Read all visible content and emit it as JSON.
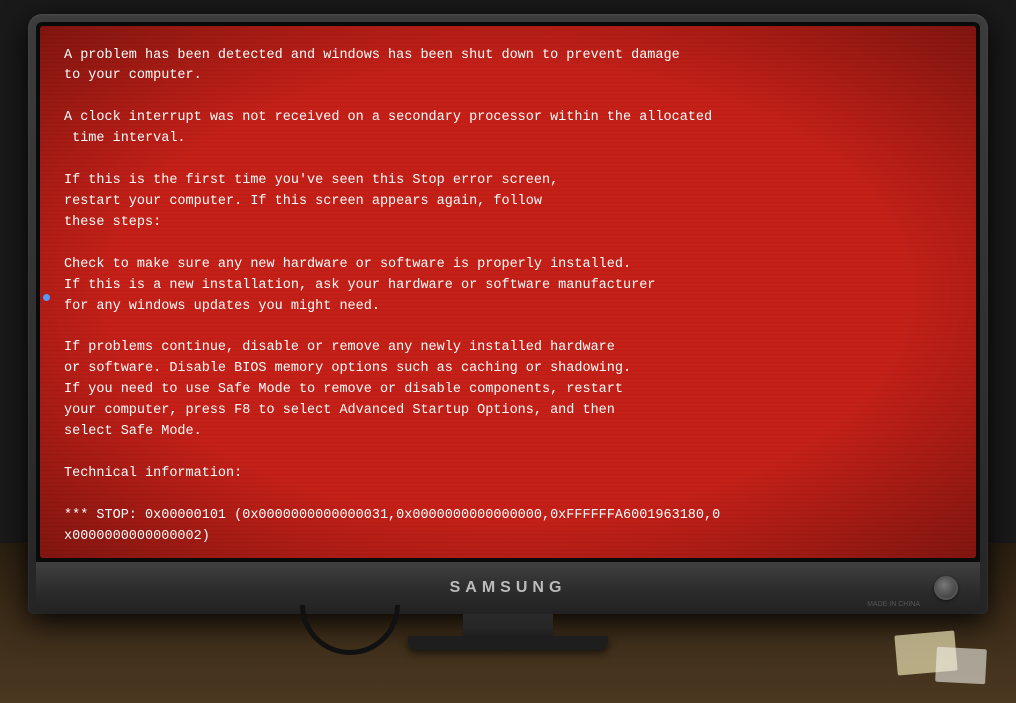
{
  "screen": {
    "background_color": "#c0201a",
    "text_color": "#ffffff",
    "lines": [
      "A problem has been detected and windows has been shut down to prevent damage",
      "to your computer.",
      "",
      "A clock interrupt was not received on a secondary processor within the allocated",
      " time interval.",
      "",
      "If this is the first time you've seen this Stop error screen,",
      "restart your computer. If this screen appears again, follow",
      "these steps:",
      "",
      "Check to make sure any new hardware or software is properly installed.",
      "If this is a new installation, ask your hardware or software manufacturer",
      "for any windows updates you might need.",
      "",
      "If problems continue, disable or remove any newly installed hardware",
      "or software. Disable BIOS memory options such as caching or shadowing.",
      "If you need to use Safe Mode to remove or disable components, restart",
      "your computer, press F8 to select Advanced Startup Options, and then",
      "select Safe Mode.",
      "",
      "Technical information:",
      "",
      "*** STOP: 0x00000101 (0x0000000000000031,0x0000000000000000,0xFFFFFFA6001963180,0",
      "x0000000000000002)"
    ]
  },
  "monitor": {
    "brand": "SAMSUNG"
  }
}
